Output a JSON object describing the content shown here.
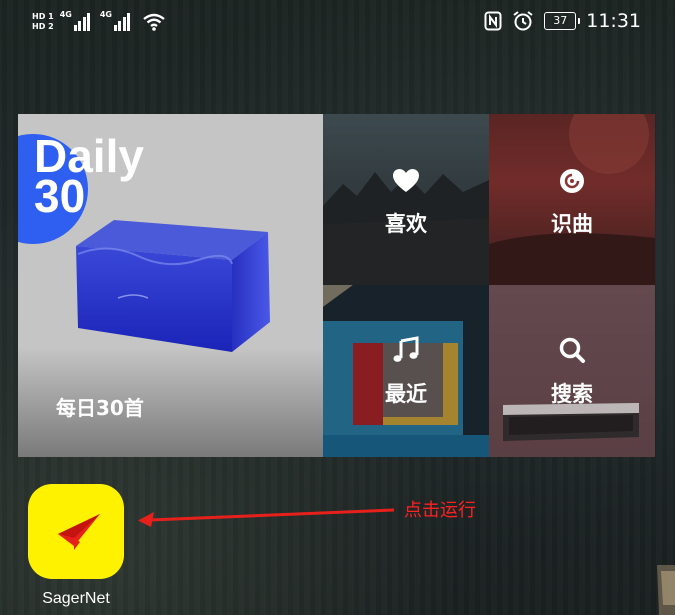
{
  "status_bar": {
    "sim1": "HD 1",
    "sim2": "HD 2",
    "net1": "4G",
    "net2": "4G",
    "battery": "37",
    "time": "11:31",
    "icons": [
      "signal-icon",
      "wifi-icon",
      "nfc-icon",
      "alarm-icon",
      "battery-icon"
    ]
  },
  "widget": {
    "daily": {
      "logo_line1": "Daily",
      "logo_line2": "30",
      "label": "每日30首"
    },
    "tiles": [
      {
        "label": "喜欢",
        "icon": "heart-icon"
      },
      {
        "label": "识曲",
        "icon": "music-recognition-icon"
      },
      {
        "label": "最近",
        "icon": "music-note-icon"
      },
      {
        "label": "搜索",
        "icon": "search-icon"
      }
    ]
  },
  "app": {
    "name": "SagerNet",
    "icon": "paper-plane-icon",
    "icon_bg": "#fff200",
    "icon_fg": "#e8201c"
  },
  "annotation": {
    "text": "点击运行",
    "color": "#ff2020"
  }
}
